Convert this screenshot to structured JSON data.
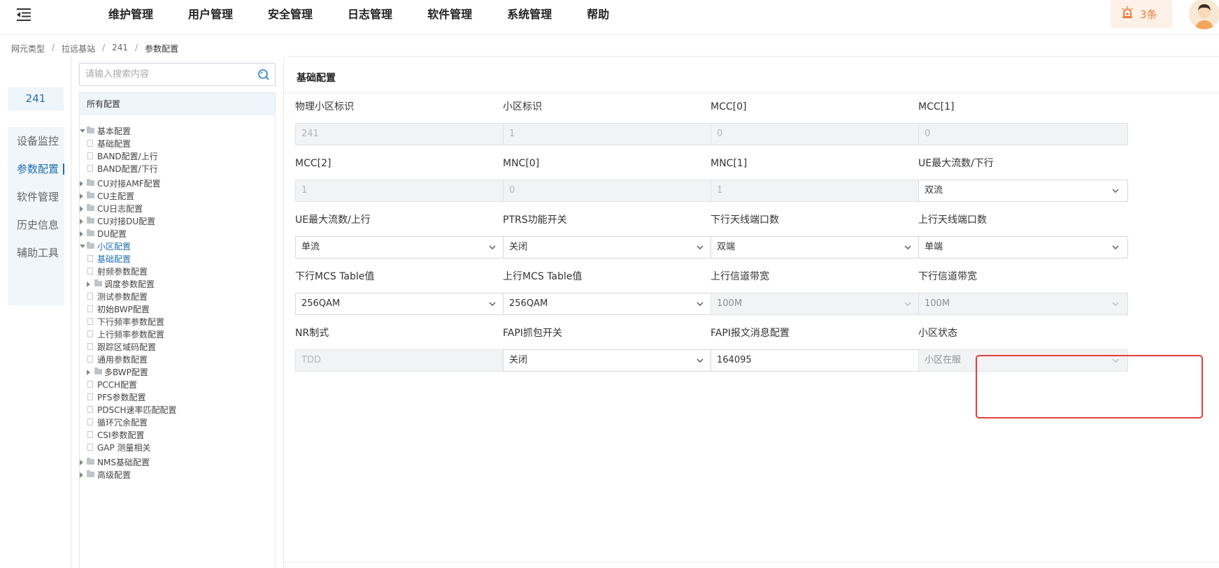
{
  "header": {
    "nav": [
      "维护管理",
      "用户管理",
      "安全管理",
      "日志管理",
      "软件管理",
      "系统管理",
      "帮助"
    ],
    "alarm_count": "3条"
  },
  "breadcrumb": [
    "网元类型",
    "拉远基站",
    "241",
    "参数配置"
  ],
  "rail": {
    "tag": "241",
    "items": [
      "设备监控",
      "参数配置",
      "软件管理",
      "历史信息",
      "辅助工具"
    ],
    "active": "参数配置"
  },
  "tree": {
    "search_placeholder": "请输入搜索内容",
    "header": "所有配置",
    "nodes": [
      {
        "label": "基本配置",
        "type": "folder",
        "level": 0,
        "expanded": true
      },
      {
        "label": "基础配置",
        "type": "file",
        "level": 1
      },
      {
        "label": "BAND配置/上行",
        "type": "file",
        "level": 1
      },
      {
        "label": "BAND配置/下行",
        "type": "file",
        "level": 1
      },
      {
        "label": "CU对接AMF配置",
        "type": "folder",
        "level": 0,
        "expanded": false
      },
      {
        "label": "CU主配置",
        "type": "folder",
        "level": 0,
        "expanded": false
      },
      {
        "label": "CU日志配置",
        "type": "folder",
        "level": 0,
        "expanded": false
      },
      {
        "label": "CU对接DU配置",
        "type": "folder",
        "level": 0,
        "expanded": false
      },
      {
        "label": "DU配置",
        "type": "folder",
        "level": 0,
        "expanded": false
      },
      {
        "label": "小区配置",
        "type": "folder",
        "level": 0,
        "expanded": true,
        "selected": true
      },
      {
        "label": "基础配置",
        "type": "file",
        "level": 1,
        "selected": true
      },
      {
        "label": "射频参数配置",
        "type": "file",
        "level": 1
      },
      {
        "label": "调度参数配置",
        "type": "folder",
        "level": 1,
        "expanded": false
      },
      {
        "label": "测试参数配置",
        "type": "file",
        "level": 1
      },
      {
        "label": "初始BWP配置",
        "type": "file",
        "level": 1
      },
      {
        "label": "下行频率参数配置",
        "type": "file",
        "level": 1
      },
      {
        "label": "上行频率参数配置",
        "type": "file",
        "level": 1
      },
      {
        "label": "跟踪区域码配置",
        "type": "file",
        "level": 1
      },
      {
        "label": "通用参数配置",
        "type": "file",
        "level": 1
      },
      {
        "label": "多BWP配置",
        "type": "folder",
        "level": 1,
        "expanded": false
      },
      {
        "label": "PCCH配置",
        "type": "file",
        "level": 1
      },
      {
        "label": "PFS参数配置",
        "type": "file",
        "level": 1
      },
      {
        "label": "PDSCH速率匹配配置",
        "type": "file",
        "level": 1
      },
      {
        "label": "循环冗余配置",
        "type": "file",
        "level": 1
      },
      {
        "label": "CSI参数配置",
        "type": "file",
        "level": 1
      },
      {
        "label": "GAP 测量相关",
        "type": "file",
        "level": 1
      },
      {
        "label": "NMS基础配置",
        "type": "folder",
        "level": 0,
        "expanded": false
      },
      {
        "label": "高级配置",
        "type": "folder",
        "level": 0,
        "expanded": false
      }
    ]
  },
  "main": {
    "section_title": "基础配置",
    "fields": [
      {
        "label": "物理小区标识",
        "value": "241",
        "kind": "input",
        "disabled": true
      },
      {
        "label": "小区标识",
        "value": "1",
        "kind": "input",
        "disabled": true
      },
      {
        "label": "MCC[0]",
        "value": "0",
        "kind": "input",
        "disabled": true
      },
      {
        "label": "MCC[1]",
        "value": "0",
        "kind": "input",
        "disabled": true
      },
      {
        "label": "MCC[2]",
        "value": "1",
        "kind": "input",
        "disabled": true
      },
      {
        "label": "MNC[0]",
        "value": "0",
        "kind": "input",
        "disabled": true
      },
      {
        "label": "MNC[1]",
        "value": "1",
        "kind": "input",
        "disabled": true
      },
      {
        "label": "UE最大流数/下行",
        "value": "双流",
        "kind": "select",
        "disabled": false
      },
      {
        "label": "UE最大流数/上行",
        "value": "单流",
        "kind": "select",
        "disabled": false
      },
      {
        "label": "PTRS功能开关",
        "value": "关闭",
        "kind": "select",
        "disabled": false
      },
      {
        "label": "下行天线端口数",
        "value": "双端",
        "kind": "select",
        "disabled": false
      },
      {
        "label": "上行天线端口数",
        "value": "单端",
        "kind": "select",
        "disabled": false
      },
      {
        "label": "下行MCS Table值",
        "value": "256QAM",
        "kind": "select",
        "disabled": false
      },
      {
        "label": "上行MCS Table值",
        "value": "256QAM",
        "kind": "select",
        "disabled": false
      },
      {
        "label": "上行信道带宽",
        "value": "100M",
        "kind": "select",
        "disabled": true
      },
      {
        "label": "下行信道带宽",
        "value": "100M",
        "kind": "select",
        "disabled": true
      },
      {
        "label": "NR制式",
        "value": "TDD",
        "kind": "input",
        "disabled": true
      },
      {
        "label": "FAPI抓包开关",
        "value": "关闭",
        "kind": "select",
        "disabled": false
      },
      {
        "label": "FAPI报文消息配置",
        "value": "164095",
        "kind": "input",
        "disabled": false
      },
      {
        "label": "小区状态",
        "value": "小区在服",
        "kind": "select",
        "disabled": true
      }
    ]
  },
  "colors": {
    "accent": "#1f6fb2",
    "highlight": "#e23d3d",
    "alarm": "#f07a3a"
  }
}
